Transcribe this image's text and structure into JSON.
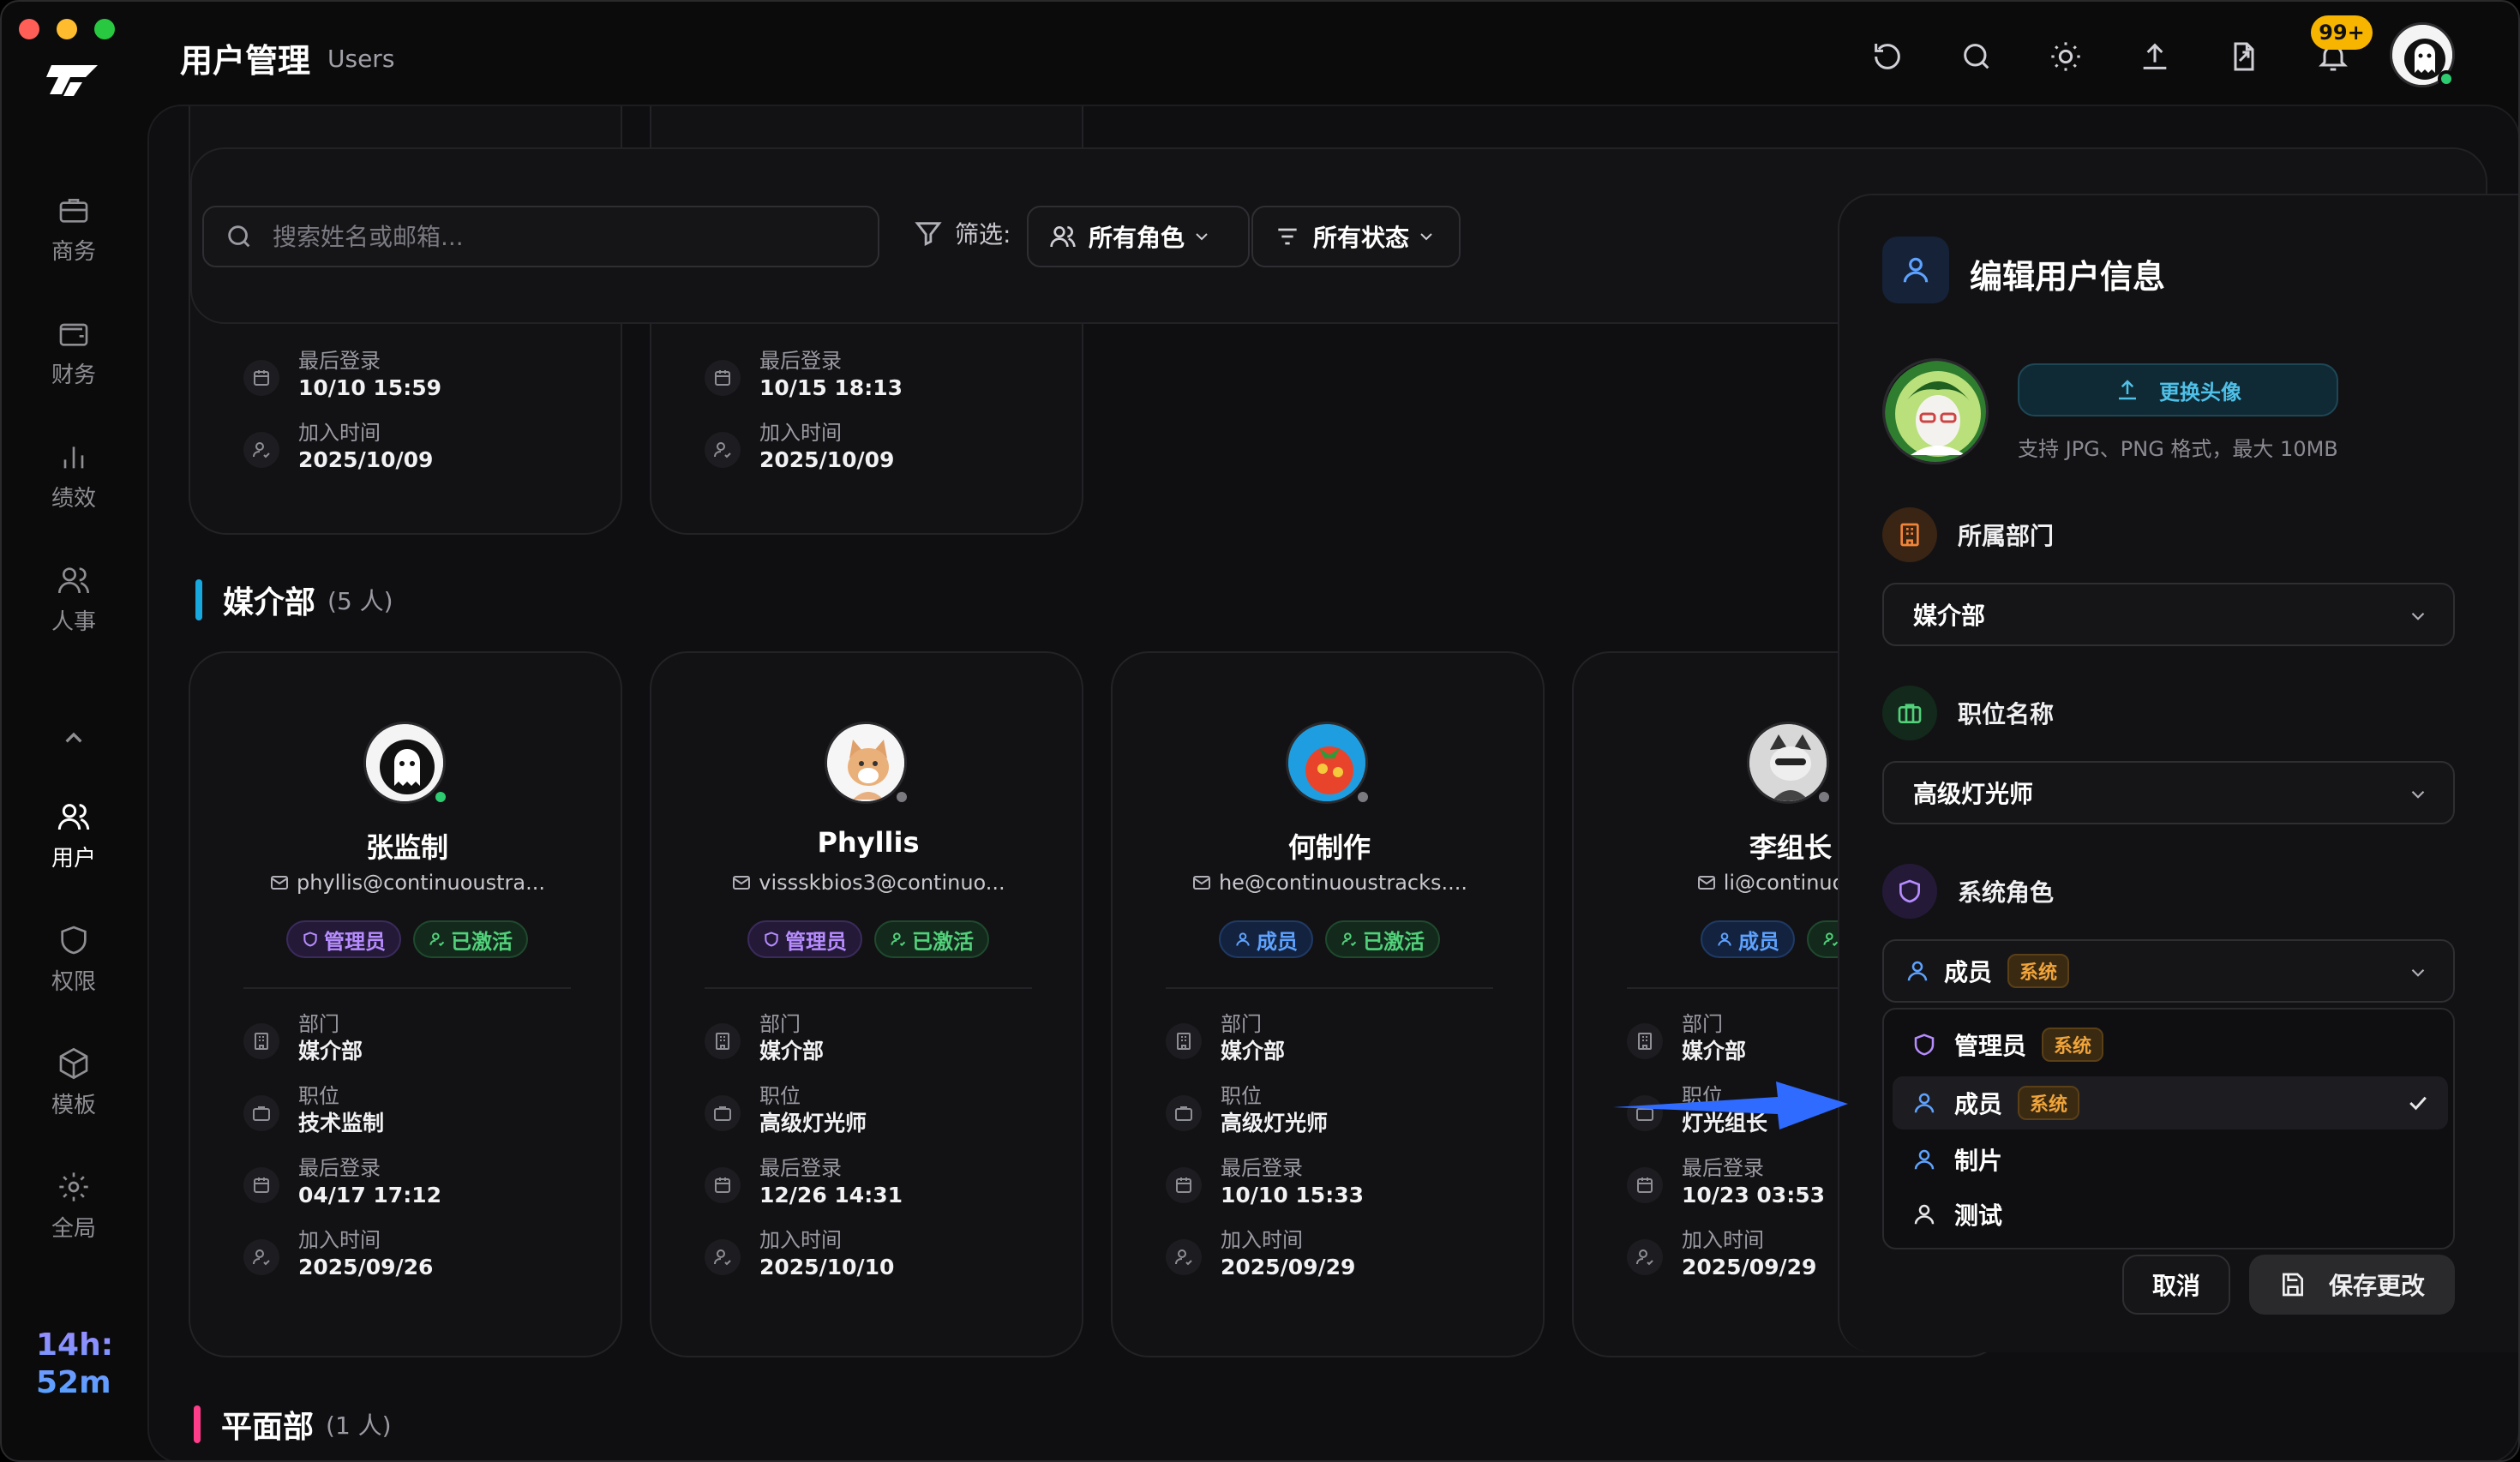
{
  "header": {
    "title": "用户管理",
    "subtitle": "Users",
    "notifications_badge": "99+",
    "icons": [
      "refresh-icon",
      "search-icon",
      "sun-icon",
      "upload-icon",
      "file-export-icon",
      "bell-icon"
    ]
  },
  "sidebar": {
    "items": [
      {
        "label": "商务",
        "icon": "briefcase-icon"
      },
      {
        "label": "财务",
        "icon": "wallet-icon"
      },
      {
        "label": "绩效",
        "icon": "bar-chart-icon"
      },
      {
        "label": "人事",
        "icon": "people-icon"
      },
      {
        "label": "用户",
        "icon": "users-icon",
        "active": true
      },
      {
        "label": "权限",
        "icon": "shield-icon"
      },
      {
        "label": "模板",
        "icon": "cube-icon"
      },
      {
        "label": "全局",
        "icon": "gear-icon"
      }
    ],
    "timer_hours": "14h:",
    "timer_minutes": "52m"
  },
  "filters": {
    "search_placeholder": "搜索姓名或邮箱...",
    "filter_label": "筛选:",
    "role_select": "所有角色",
    "status_select": "所有状态"
  },
  "partial_cards": [
    {
      "last_login_label": "最后登录",
      "last_login": "10/10 15:59",
      "joined_label": "加入时间",
      "joined": "2025/10/09"
    },
    {
      "last_login_label": "最后登录",
      "last_login": "10/15 18:13",
      "joined_label": "加入时间",
      "joined": "2025/10/09"
    }
  ],
  "section_media": {
    "title": "媒介部",
    "count": "(5 人)"
  },
  "labels": {
    "dept": "部门",
    "position": "职位",
    "last_login": "最后登录",
    "joined": "加入时间"
  },
  "users": [
    {
      "name": "张监制",
      "email": "phyllis@continuoustra...",
      "role": "管理员",
      "role_type": "admin",
      "status": "已激活",
      "dept": "媒介部",
      "position": "技术监制",
      "last_login": "04/17 17:12",
      "joined": "2025/09/26",
      "online": true
    },
    {
      "name": "Phyllis",
      "email": "vissskbios3@continuo...",
      "role": "管理员",
      "role_type": "admin",
      "status": "已激活",
      "dept": "媒介部",
      "position": "高级灯光师",
      "last_login": "12/26 14:31",
      "joined": "2025/10/10",
      "online": false
    },
    {
      "name": "何制作",
      "email": "he@continuoustracks....",
      "role": "成员",
      "role_type": "member",
      "status": "已激活",
      "dept": "媒介部",
      "position": "高级灯光师",
      "last_login": "10/10 15:33",
      "joined": "2025/09/29",
      "online": false
    },
    {
      "name": "李组长",
      "email": "li@continuoustr",
      "role": "成员",
      "role_type": "member",
      "status": "已",
      "dept": "媒介部",
      "position": "灯光组长",
      "position_label": "职位",
      "last_login": "10/23 03:53",
      "joined": "2025/09/29",
      "online": false
    }
  ],
  "section_next": {
    "title": "平面部",
    "count": "(1 人)"
  },
  "edit_panel": {
    "title": "编辑用户信息",
    "upload_button": "更换头像",
    "upload_hint": "支持 JPG、PNG 格式，最大 10MB",
    "dept_label": "所属部门",
    "dept_value": "媒介部",
    "position_label": "职位名称",
    "position_value": "高级灯光师",
    "role_label": "系统角色",
    "role_value": "成员",
    "role_tag": "系统",
    "menu": [
      {
        "label": "管理员",
        "tag": "系统",
        "icon": "shield-icon",
        "selected": false
      },
      {
        "label": "成员",
        "tag": "系统",
        "icon": "user-icon",
        "selected": true
      },
      {
        "label": "制片",
        "tag": "",
        "icon": "user-icon",
        "selected": false
      },
      {
        "label": "测试",
        "tag": "",
        "icon": "user-icon",
        "selected": false
      }
    ],
    "cancel_button": "取消",
    "save_button": "保存更改"
  },
  "colors": {
    "accent_blue": "#5ea2ff",
    "accent_cyan": "#18a8e0",
    "admin_purple": "#b68cff",
    "active_green": "#52d17a",
    "system_tag_orange": "#f0a43a",
    "annotation_arrow": "#2f6bff"
  }
}
